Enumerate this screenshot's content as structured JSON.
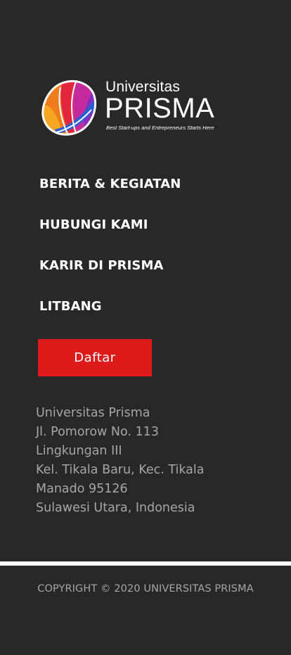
{
  "logo": {
    "name_small": "Universitas",
    "name_big": "PRISMA",
    "tagline": "Best Start-ups and Entrepreneurs Starts Here"
  },
  "nav": {
    "items": [
      {
        "label": "BERITA & KEGIATAN"
      },
      {
        "label": "HUBUNGI KAMI"
      },
      {
        "label": "KARIR DI PRISMA"
      },
      {
        "label": "LITBANG"
      }
    ]
  },
  "cta": {
    "label": "Daftar",
    "color": "#de1a1a"
  },
  "address": {
    "lines": [
      "Universitas Prisma",
      "Jl. Pomorow No. 113",
      "Lingkungan III",
      "Kel. Tikala Baru, Kec. Tikala",
      "Manado 95126",
      "Sulawesi Utara, Indonesia"
    ]
  },
  "footer": {
    "copyright": "COPYRIGHT © 2020 UNIVERSITAS PRISMA"
  },
  "theme": {
    "background": "#282828",
    "accent": "#de1a1a"
  }
}
